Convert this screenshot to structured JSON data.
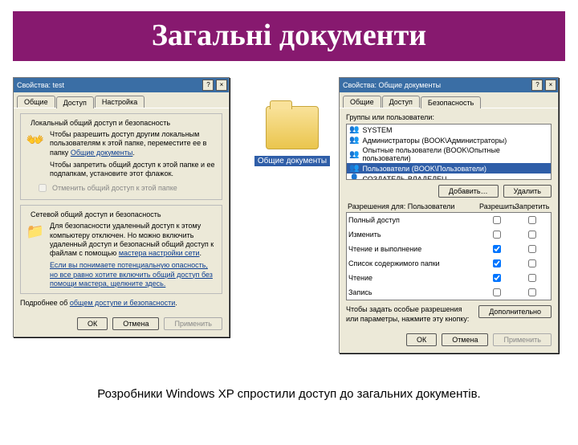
{
  "slide": {
    "title": "Загальні документи",
    "caption": "Розробники Windows XP спростили доступ до загальних документів."
  },
  "folder": {
    "label": "Общие документы"
  },
  "dlg1": {
    "title": "Свойства: test",
    "tabs": [
      "Общие",
      "Доступ",
      "Настройка"
    ],
    "active_tab": 1,
    "group1_title": "Локальный общий доступ и безопасность",
    "group1_text": "Чтобы разрешить доступ другим локальным пользователям к этой папке, переместите ее в папку",
    "group1_link": "Общие документы",
    "group1_text2": "Чтобы запретить общий доступ к этой папке и ее подпапкам, установите этот флажок.",
    "group1_checkbox": "Отменить общий доступ к этой папке",
    "group2_title": "Сетевой общий доступ и безопасность",
    "group2_text": "Для безопасности удаленный доступ к этому компьютеру отключен. Но можно включить удаленный доступ и безопасный общий доступ к файлам с помощью",
    "group2_link": "мастера настройки сети",
    "group2_note": "Если вы понимаете потенциальную опасность, но все равно хотите включить общий доступ без помощи мастера, щелкните здесь.",
    "moreinfo_prefix": "Подробнее об",
    "moreinfo_link": "общем доступе и безопасности",
    "ok": "ОК",
    "cancel": "Отмена",
    "apply": "Применить"
  },
  "dlg2": {
    "title": "Свойства: Общие документы",
    "tabs": [
      "Общие",
      "Доступ",
      "Безопасность"
    ],
    "active_tab": 2,
    "groups_label": "Группы или пользователи:",
    "groups": [
      "SYSTEM",
      "Администраторы (BOOK\\Администраторы)",
      "Опытные пользователи (BOOK\\Опытные пользователи)",
      "Пользователи (BOOK\\Пользователи)",
      "СОЗДАТЕЛЬ-ВЛАДЕЛЕЦ"
    ],
    "selected_group_index": 3,
    "add": "Добавить…",
    "remove": "Удалить",
    "perms_for": "Разрешения для: Пользователи",
    "allow": "Разрешить",
    "deny": "Запретить",
    "perms": [
      {
        "name": "Полный доступ",
        "allow": false,
        "deny": false
      },
      {
        "name": "Изменить",
        "allow": false,
        "deny": false
      },
      {
        "name": "Чтение и выполнение",
        "allow": true,
        "deny": false
      },
      {
        "name": "Список содержимого папки",
        "allow": true,
        "deny": false
      },
      {
        "name": "Чтение",
        "allow": true,
        "deny": false
      },
      {
        "name": "Запись",
        "allow": false,
        "deny": false
      }
    ],
    "special_note": "Чтобы задать особые разрешения или параметры, нажмите эту кнопку:",
    "advanced": "Дополнительно",
    "ok": "ОК",
    "cancel": "Отмена",
    "apply": "Применить"
  }
}
